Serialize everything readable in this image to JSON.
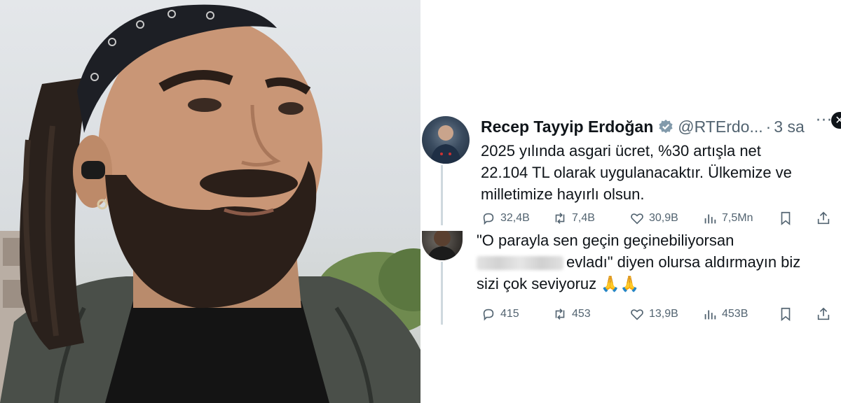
{
  "tweet": {
    "author_name": "Recep Tayyip Erdoğan",
    "handle": "@RTErdo...",
    "separator": "·",
    "time": "3 sa",
    "text_line1": "2025 yılında asgari ücret, %30 artışla net",
    "text_line2": "22.104 TL olarak uygulanacaktır. Ülkemize ve",
    "text_line3": "milletimize hayırlı olsun.",
    "replies": "32,4B",
    "retweets": "7,4B",
    "likes": "30,9B",
    "views": "7,5Mn"
  },
  "reply": {
    "text_line1": "\"O parayla sen geçin geçinebiliyorsan",
    "text_line2": "evladı\" diyen olursa aldırmayın biz",
    "text_line3": "sizi çok seviyoruz 🙏🙏",
    "replies": "415",
    "retweets": "453",
    "likes": "13,9B",
    "views": "453B"
  },
  "colors": {
    "text": "#0f1419",
    "muted": "#536471",
    "verified": "#829aab"
  }
}
